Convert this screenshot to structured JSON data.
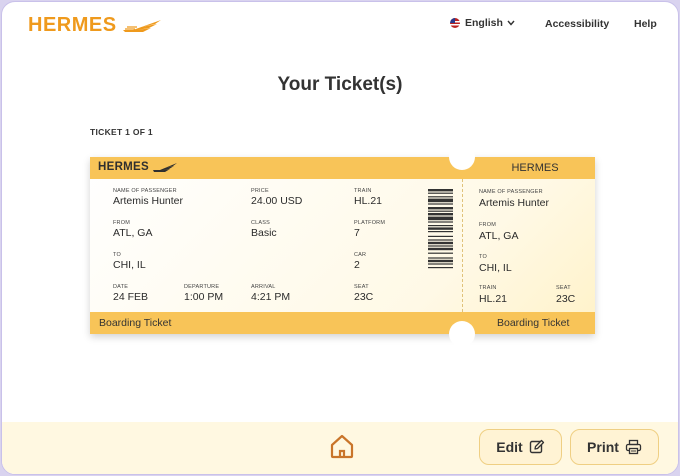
{
  "header": {
    "logo": "HERMES",
    "language": "English",
    "links": [
      "Accessibility",
      "Help"
    ]
  },
  "page_title": "Your Ticket(s)",
  "ticket_count": "TICKET 1 OF 1",
  "ticket": {
    "brand": "HERMES",
    "band_label": "Boarding Ticket",
    "labels": {
      "passenger": "NAME OF PASSENGER",
      "price": "PRICE",
      "train": "TRAIN",
      "from": "FROM",
      "class": "CLASS",
      "platform": "PLATFORM",
      "to": "TO",
      "car": "CAR",
      "date": "DATE",
      "departure": "DEPARTURE",
      "arrival": "ARRIVAL",
      "seat": "SEAT"
    },
    "passenger": "Artemis Hunter",
    "price": "24.00 USD",
    "train": "HL.21",
    "from": "ATL, GA",
    "class": "Basic",
    "platform": "7",
    "to": "CHI, IL",
    "car": "2",
    "date": "24 FEB",
    "departure": "1:00 PM",
    "arrival": "4:21 PM",
    "seat": "23C"
  },
  "footer": {
    "edit_label": "Edit",
    "print_label": "Print"
  },
  "colors": {
    "brand_orange": "#ef9a1d",
    "ticket_band": "#f8c458",
    "footer_bg": "#fff8e1",
    "frame_border": "#c9c1ea"
  },
  "icons": [
    "wing-icon",
    "flag-icon",
    "chevron-down-icon",
    "home-icon",
    "edit-icon",
    "printer-icon"
  ]
}
